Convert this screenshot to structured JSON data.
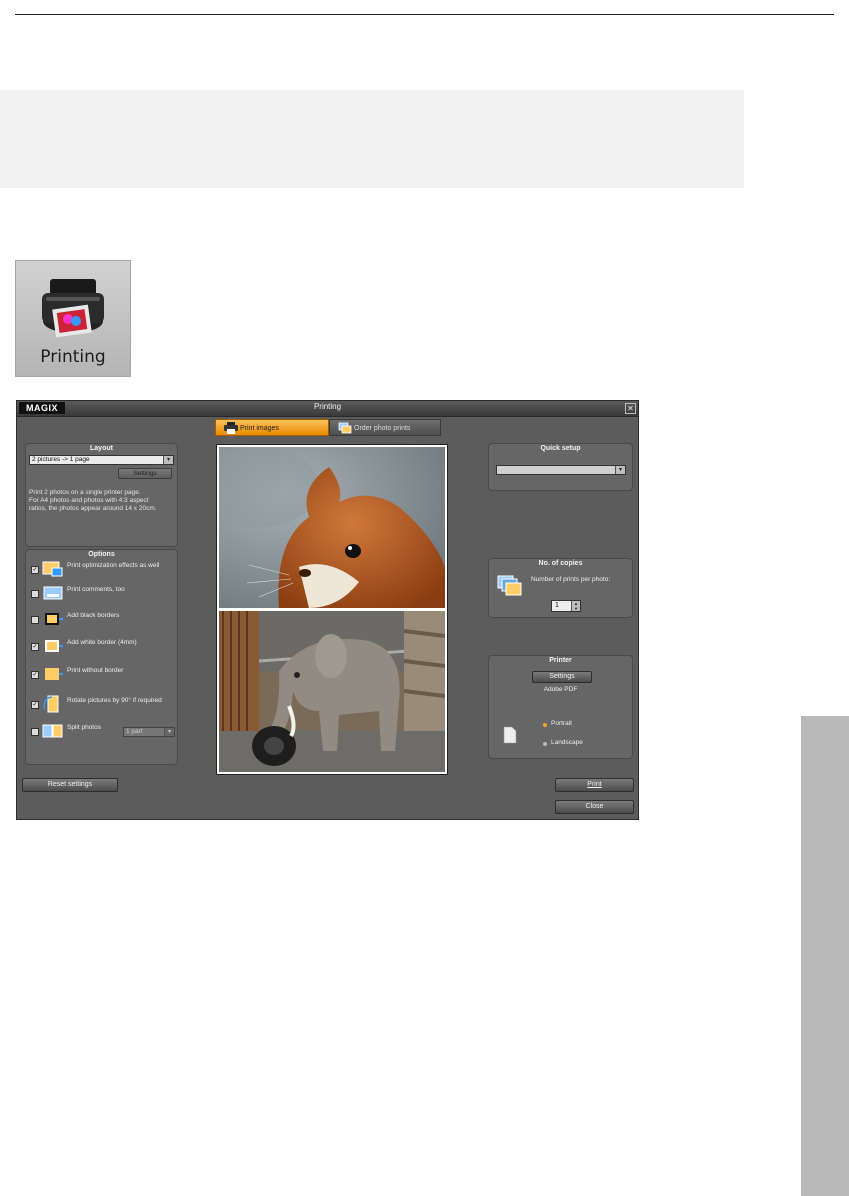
{
  "icon_tile": {
    "label": "Printing"
  },
  "dialog": {
    "logo": "MAGIX",
    "title": "Printing",
    "close_glyph": "✕",
    "tabs": [
      {
        "label": "Print images",
        "active": true
      },
      {
        "label": "Order photo prints",
        "active": false
      }
    ],
    "layout": {
      "title": "Layout",
      "selected": "2 pictures -> 1 page",
      "settings_label": "Settings",
      "description_lines": [
        "Print 2 photos on a single printer page.",
        "For A4 photos and photos with 4:3 aspect",
        "ratios, the photos appear around 14 x 20cm."
      ]
    },
    "options": {
      "title": "Options",
      "items": [
        {
          "label": "Print optimization effects as well",
          "checked": true
        },
        {
          "label": "Print comments, too",
          "checked": false
        },
        {
          "label": "Add black borders",
          "checked": false
        },
        {
          "label": "Add white border (4mm)",
          "checked": true
        },
        {
          "label": "Print without border",
          "checked": true
        },
        {
          "label": "Rotate pictures by 90° if required",
          "checked": true
        },
        {
          "label": "Split photos",
          "checked": false
        }
      ],
      "split_parts": "1 part"
    },
    "quick_setup": {
      "title": "Quick setup",
      "selected": ""
    },
    "copies": {
      "title": "No. of copies",
      "label": "Number of prints per photo:",
      "value": "1"
    },
    "printer": {
      "title": "Printer",
      "settings_label": "Settings",
      "name": "Adobe PDF",
      "orientation_portrait": "Portrait",
      "orientation_landscape": "Landscape",
      "selected_orientation": "Portrait"
    },
    "buttons": {
      "reset": "Reset settings",
      "print": "Print",
      "close": "Close"
    },
    "colors": {
      "accent_orange": "#f5a623",
      "dialog_bg": "#5c5c5c"
    }
  }
}
